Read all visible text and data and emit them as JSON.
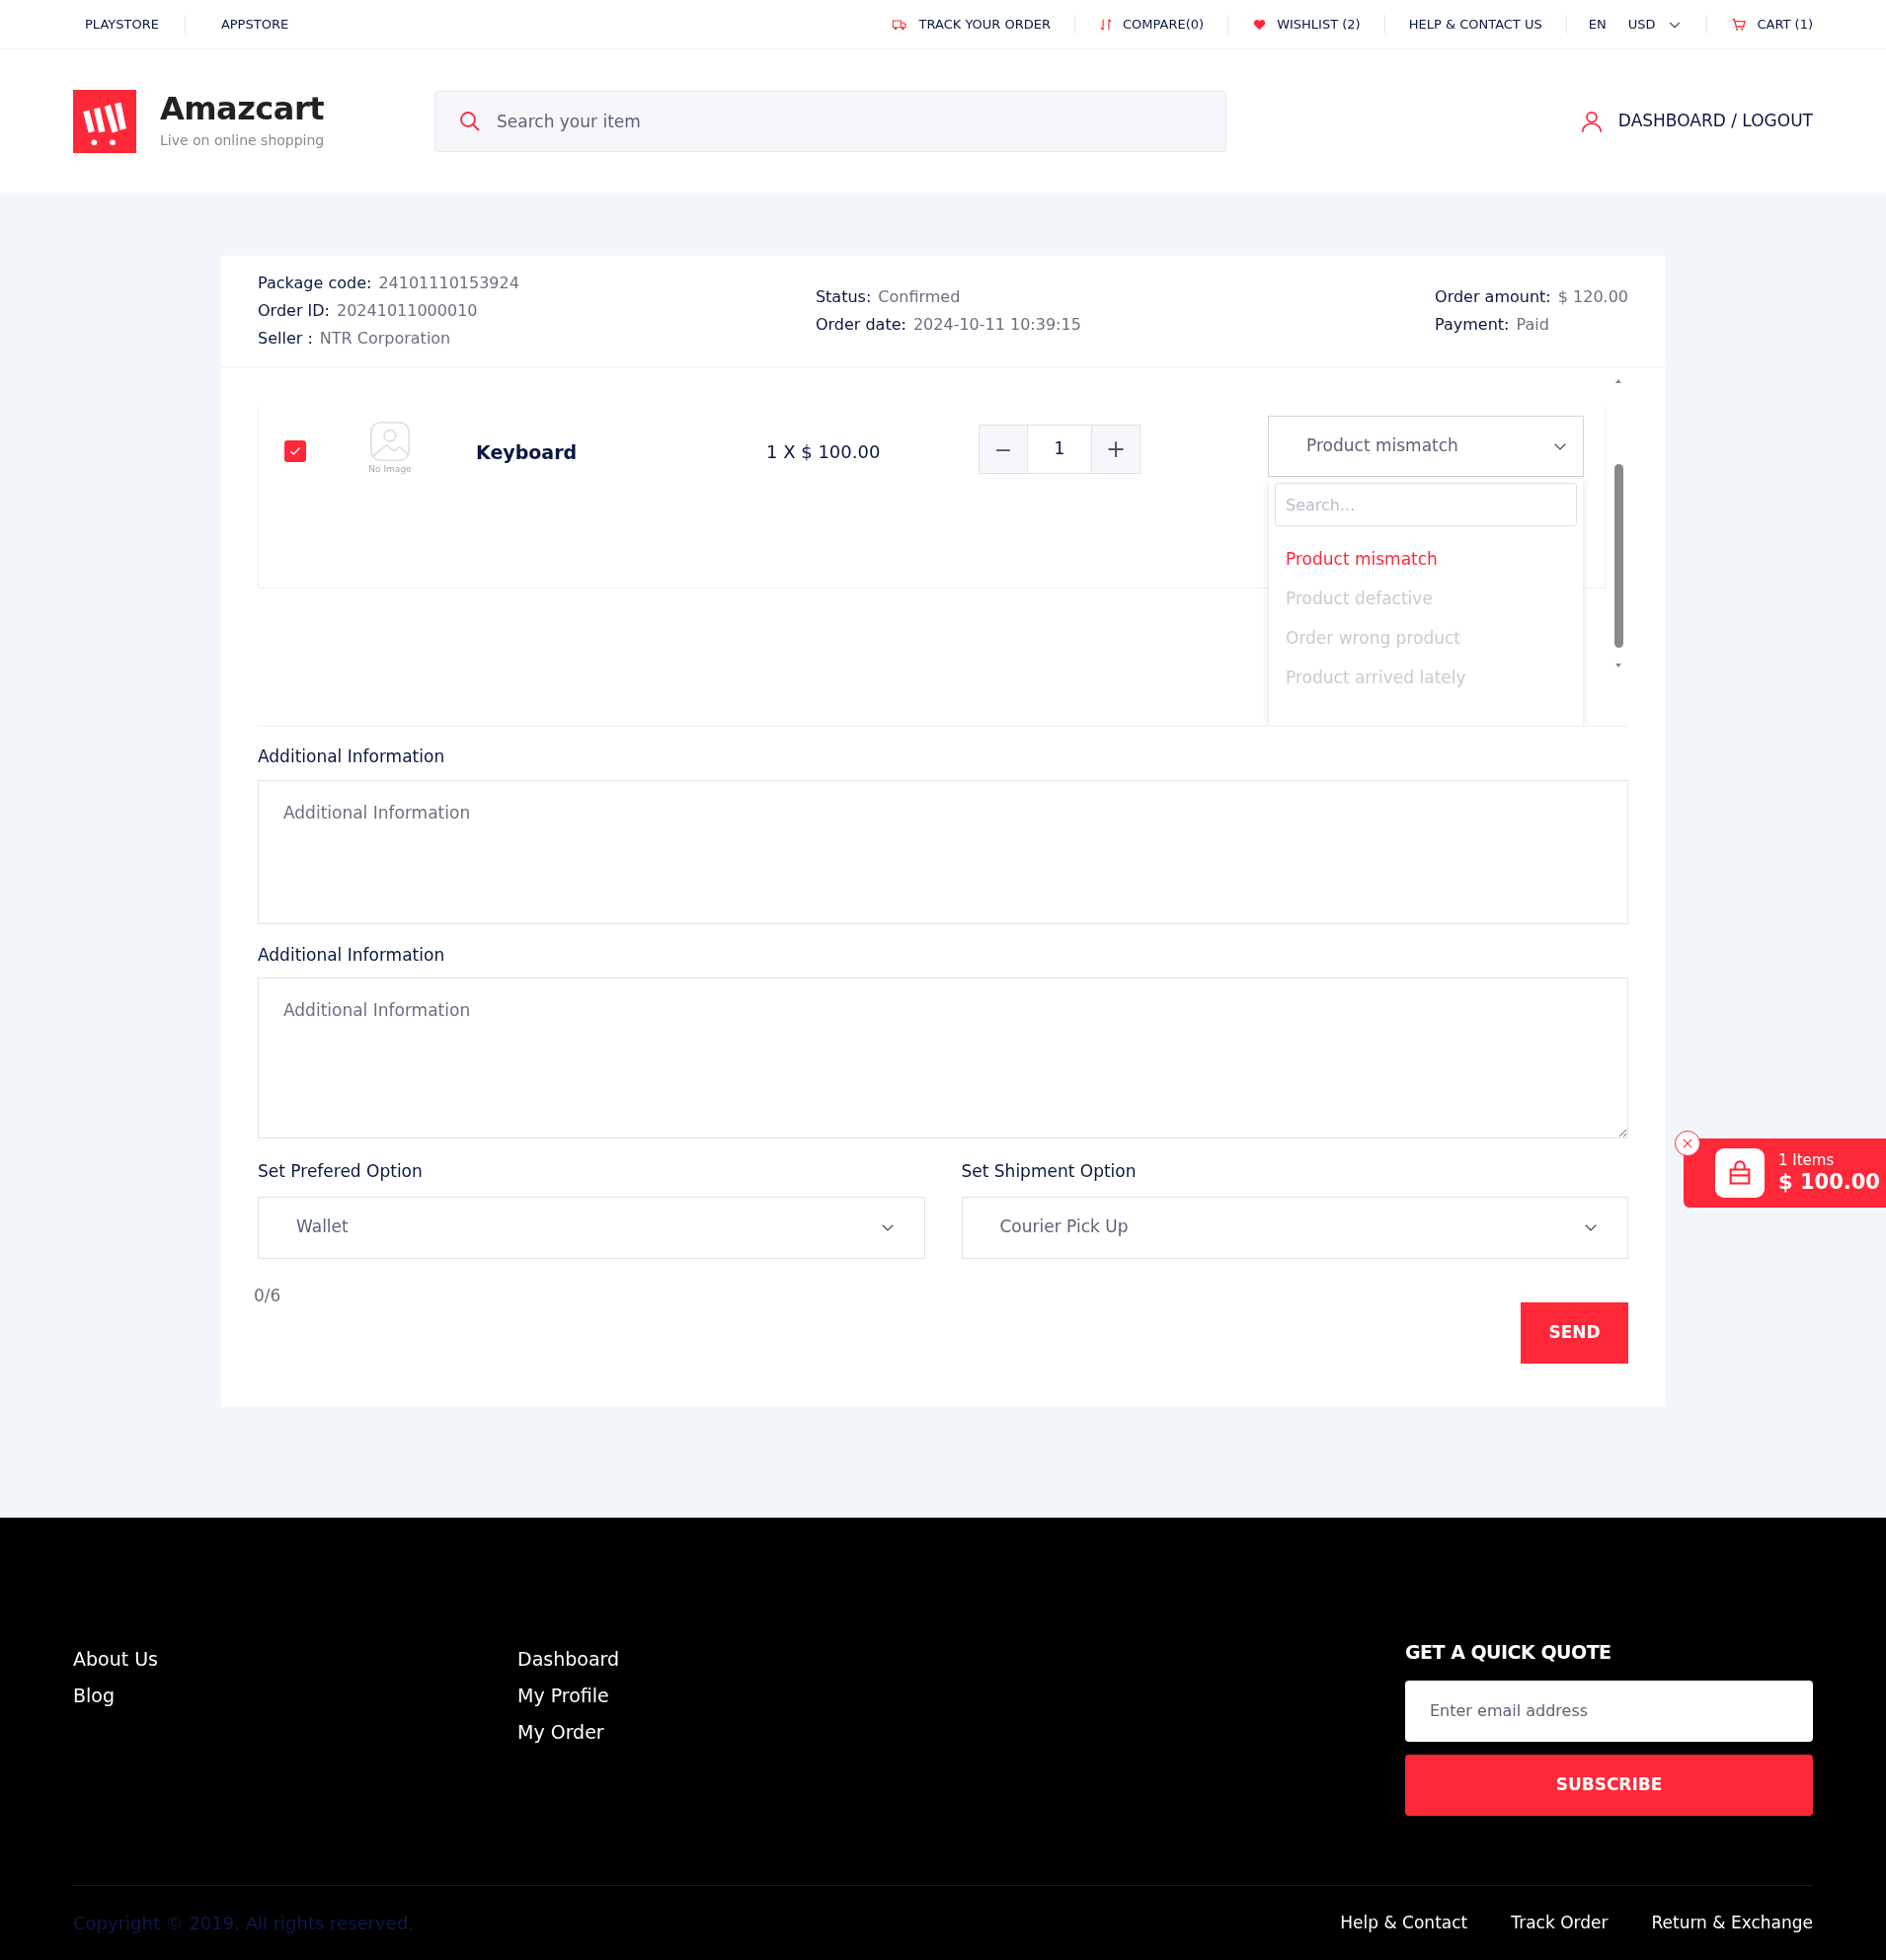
{
  "top_bar": {
    "left_links": [
      "PLAYSTORE",
      "APPSTORE"
    ],
    "right_links": [
      {
        "kind": "truck",
        "label": "TRACK YOUR ORDER"
      },
      {
        "kind": "sort",
        "label": "COMPARE(0)"
      },
      {
        "kind": "heart",
        "label": "WISHLIST (2)"
      },
      {
        "kind": "none",
        "label": "HELP & CONTACT US"
      }
    ],
    "language": "EN",
    "currency": "USD",
    "cart": "CART (1)"
  },
  "header": {
    "logo_name": "Amazcart",
    "logo_tagline": "Live on online shopping",
    "search": {
      "placeholder": "Search your item"
    },
    "account": "DASHBOARD / LOGOUT"
  },
  "order": {
    "columns": [
      [
        {
          "label": "Package code:",
          "value": "24101110153924"
        },
        {
          "label": "Order ID:",
          "value": "20241011000010"
        },
        {
          "label": "Seller :",
          "value": "NTR Corporation"
        }
      ],
      [
        {
          "label": "Status:",
          "value": "Confirmed"
        },
        {
          "label": "Order date:",
          "value": "2024-10-11 10:39:15"
        }
      ],
      [
        {
          "label": "Order amount:",
          "value": "$ 120.00"
        },
        {
          "label": "Payment:",
          "value": "Paid"
        }
      ]
    ]
  },
  "product": {
    "checked": true,
    "image_caption": "No Image",
    "name": "Keyboard",
    "price": "1 X $ 100.00",
    "quantity": "1",
    "decrement": "−",
    "increment": "+",
    "reason": {
      "value": "Product mismatch",
      "expanded": true,
      "search_placeholder": "Search...",
      "options": [
        {
          "label": "Product mismatch",
          "selected": true
        },
        {
          "label": "Product defactive",
          "selected": false
        },
        {
          "label": "Order wrong product",
          "selected": false
        },
        {
          "label": "Product arrived lately",
          "selected": false
        }
      ]
    }
  },
  "additional_fields": [
    {
      "label": "Additional Information",
      "placeholder": "Additional Information"
    },
    {
      "label": "Additional Information",
      "placeholder": "Additional Information"
    }
  ],
  "options": [
    {
      "label": "Set Prefered Option",
      "value": "Wallet"
    },
    {
      "label": "Set Shipment Option",
      "value": "Courier Pick Up"
    }
  ],
  "counter": "0/6",
  "send": "SEND",
  "cart_widget": {
    "items": "1 Items",
    "total": "$ 100.00"
  },
  "footer": {
    "columns": [
      [
        "About Us",
        "Blog"
      ],
      [
        "Dashboard",
        "My Profile",
        "My Order"
      ]
    ],
    "quote": {
      "title": "GET A QUICK QUOTE",
      "placeholder": "Enter email address",
      "button": "SUBSCRIBE"
    },
    "copyright": "Copyright © 2019. All rights reserved.",
    "bottom_links": [
      "Help & Contact",
      "Track Order",
      "Return & Exchange"
    ]
  }
}
